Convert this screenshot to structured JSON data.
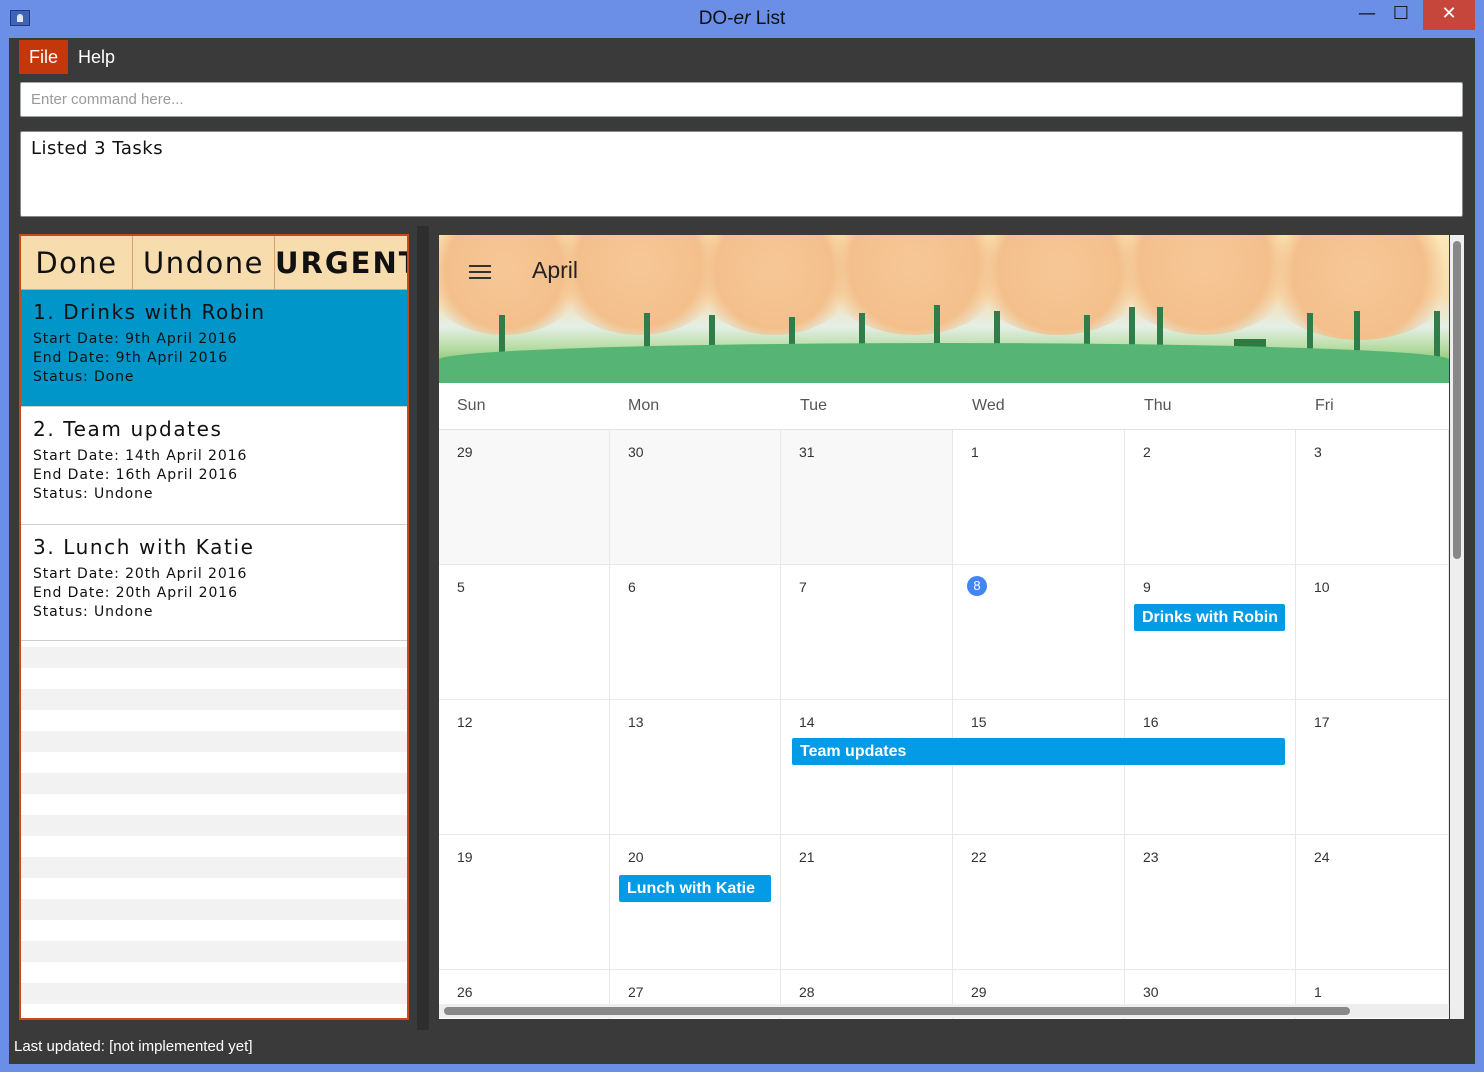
{
  "window": {
    "title": "DO-er List",
    "title_plain": "DO-",
    "title_italic": "er",
    "title_rest": " List",
    "min_glyph": "—",
    "max_glyph": "☐",
    "close_glyph": "✕"
  },
  "menubar": {
    "file": "File",
    "help": "Help"
  },
  "command": {
    "placeholder": "Enter command here..."
  },
  "result": {
    "text": "Listed 3 Tasks"
  },
  "tabs": {
    "done": "Done",
    "undone": "Undone",
    "urgent": "URGENT"
  },
  "tasks": [
    {
      "name": "1. Drinks with Robin",
      "start": "Start Date: 9th April 2016",
      "end": "End Date: 9th April 2016",
      "status": "Status: Done"
    },
    {
      "name": "2. Team updates",
      "start": "Start Date: 14th April 2016",
      "end": "End Date: 16th April 2016",
      "status": "Status: Undone"
    },
    {
      "name": "3. Lunch with Katie",
      "start": "Start Date: 20th April 2016",
      "end": "End Date: 20th April 2016",
      "status": "Status: Undone"
    }
  ],
  "calendar": {
    "month": "April",
    "weekdays": [
      "Sun",
      "Mon",
      "Tue",
      "Wed",
      "Thu",
      "Fri"
    ],
    "weeks": [
      [
        "29",
        "30",
        "31",
        "1",
        "2",
        "3"
      ],
      [
        "5",
        "6",
        "7",
        "8",
        "9",
        "10"
      ],
      [
        "12",
        "13",
        "14",
        "15",
        "16",
        "17"
      ],
      [
        "19",
        "20",
        "21",
        "22",
        "23",
        "24"
      ],
      [
        "26",
        "27",
        "28",
        "29",
        "30",
        "1"
      ]
    ],
    "today": "8",
    "events": [
      {
        "title": "Drinks with Robin"
      },
      {
        "title": "Team updates"
      },
      {
        "title": "Lunch with Katie"
      }
    ],
    "event_color": "#039be5"
  },
  "status": {
    "text": "Last updated: [not implemented yet]"
  },
  "colors": {
    "accent": "#c3370b",
    "selected": "#0096c9",
    "today": "#4285f4"
  }
}
